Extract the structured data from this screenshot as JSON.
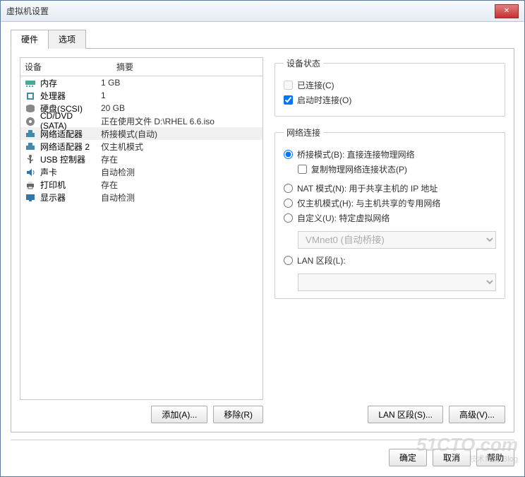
{
  "window": {
    "title": "虚拟机设置"
  },
  "tabs": {
    "hardware": "硬件",
    "options": "选项"
  },
  "device_header": {
    "device": "设备",
    "summary": "摘要"
  },
  "devices": [
    {
      "name": "内存",
      "summary": "1 GB",
      "icon": "memory"
    },
    {
      "name": "处理器",
      "summary": "1",
      "icon": "cpu"
    },
    {
      "name": "硬盘(SCSI)",
      "summary": "20 GB",
      "icon": "disk"
    },
    {
      "name": "CD/DVD (SATA)",
      "summary": "正在使用文件 D:\\RHEL 6.6.iso",
      "icon": "cd"
    },
    {
      "name": "网络适配器",
      "summary": "桥接模式(自动)",
      "icon": "net",
      "selected": true
    },
    {
      "name": "网络适配器 2",
      "summary": "仅主机模式",
      "icon": "net"
    },
    {
      "name": "USB 控制器",
      "summary": "存在",
      "icon": "usb"
    },
    {
      "name": "声卡",
      "summary": "自动检测",
      "icon": "sound"
    },
    {
      "name": "打印机",
      "summary": "存在",
      "icon": "printer"
    },
    {
      "name": "显示器",
      "summary": "自动检测",
      "icon": "display"
    }
  ],
  "left_buttons": {
    "add": "添加(A)...",
    "remove": "移除(R)"
  },
  "device_status": {
    "legend": "设备状态",
    "connected": "已连接(C)",
    "connect_at_poweron": "启动时连接(O)"
  },
  "network": {
    "legend": "网络连接",
    "bridged": "桥接模式(B): 直接连接物理网络",
    "replicate": "复制物理网络连接状态(P)",
    "nat": "NAT 模式(N): 用于共享主机的 IP 地址",
    "hostonly": "仅主机模式(H): 与主机共享的专用网络",
    "custom": "自定义(U): 特定虚拟网络",
    "custom_value": "VMnet0 (自动桥接)",
    "lan": "LAN 区段(L):",
    "lan_value": ""
  },
  "right_buttons": {
    "lan_segments": "LAN 区段(S)...",
    "advanced": "高级(V)..."
  },
  "footer": {
    "ok": "确定",
    "cancel": "取消",
    "help": "帮助"
  },
  "watermark": {
    "main": "51CTO.com",
    "sub": "技术博客 Blog"
  }
}
